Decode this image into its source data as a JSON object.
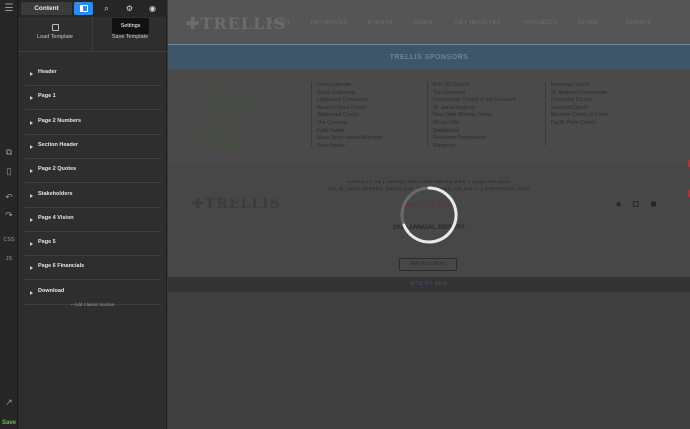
{
  "panel": {
    "content_tab": "Content",
    "load_template": "Load Template",
    "save_template": "Save Template",
    "tooltip": "Settings",
    "sections": [
      "Header",
      "Page 1",
      "Page 2 Numbers",
      "Section Header",
      "Page 2 Quotes",
      "Stakeholders",
      "Page 4 Vision",
      "Page 5",
      "Page 6 Financials",
      "Download"
    ],
    "add_section": "+ Add Classic Section"
  },
  "rail": {
    "css": "CSS",
    "js": "JS",
    "save": "Save"
  },
  "preview": {
    "logo": "TRELLIS",
    "nav": [
      "ABOUT",
      "INITIATIVES",
      "EVENTS",
      "NEWS",
      "GET INVOLVED",
      "PROJECTS",
      "STORE",
      "DONATE"
    ],
    "sponsors_title": "TRELLIS SPONSORS",
    "sponsor_cols": [
      [
        "First Baptist",
        "The Pleasant House",
        "Grace Chapel Church",
        "Trinity Community Church",
        "Living Hope Fellowship",
        "Oasis Christian",
        "Church Street",
        "Highland Bible Church",
        "Harvest Community Church"
      ],
      [
        "Christ Lutheran",
        "Grace Fellowship",
        "Lighthouse Community",
        "Newport Mesa Church",
        "Watermark Church",
        "The Crossing",
        "Faith Harbor",
        "Mesa Verde United Methodist",
        "Rock Harbor"
      ],
      [
        "Rise OC Church",
        "The Gathering",
        "Presbyterian Church of the Covenant",
        "St. James Anglican",
        "New Song Worship Center",
        "Mosaic Hills",
        "Saddleback",
        "Redeemer Presbyterian",
        "Westpoint"
      ],
      [
        "Newsong Church",
        "St. Andrews Presbyterian",
        "Friendship Church",
        "Vineyard Church",
        "Mariners Church of Costa",
        "Pacific Point Church"
      ]
    ],
    "contact_line": "CONTACT US   |   INFO@TRELLISNETWORK.ORG   |   (949) 555-0123",
    "address_line": "321 W. 18TH STREET, SUITE 120, COSTA MESA, CA 92627  |  COPYRIGHT 2019",
    "back_to_site": "BACK TO SITE",
    "report": "2019 ANNUAL REPORT",
    "story_button": "Tell Your Story",
    "site_by": "SITE BY NEW"
  }
}
